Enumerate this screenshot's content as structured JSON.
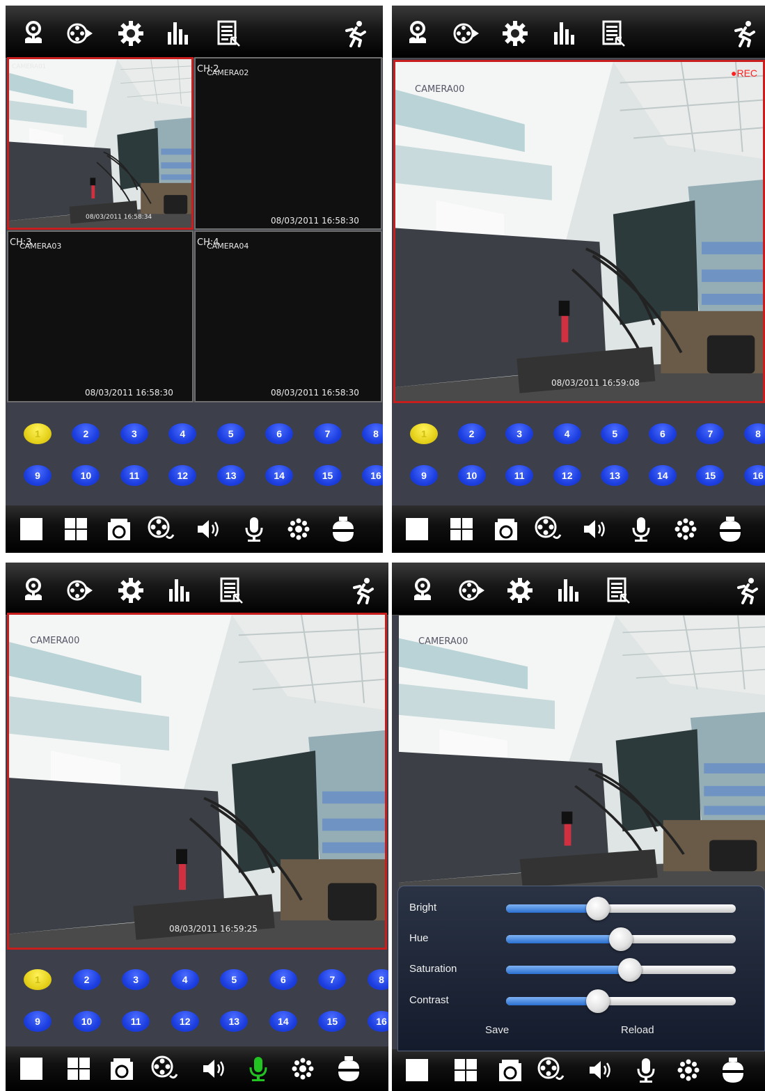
{
  "topbar_icons": [
    "ptz-flower-icon",
    "playback-icon",
    "settings-gear-icon",
    "stats-bars-icon",
    "log-list-icon",
    "motion-run-icon"
  ],
  "bottombar_icons": [
    "single-view-icon",
    "quad-view-icon",
    "snapshot-camera-icon",
    "record-film-icon",
    "speaker-audio-icon",
    "microphone-icon",
    "image-adjust-icon",
    "ptz-dome-icon"
  ],
  "channels": [
    "1",
    "2",
    "3",
    "4",
    "5",
    "6",
    "7",
    "8",
    "9",
    "10",
    "11",
    "12",
    "13",
    "14",
    "15",
    "16"
  ],
  "selected_channel": "1",
  "colors": {
    "active_border": "#c81e1e",
    "channel_blue": "#1d3fe0",
    "channel_selected": "#e6d21c",
    "mic_active": "#22c422",
    "rec_red": "#ff2020"
  },
  "screen1": {
    "cells": [
      {
        "ch": "",
        "cam": "CAMERA01",
        "timestamp": "08/03/2011 16:58:34"
      },
      {
        "ch": "CH:2",
        "cam": "CAMERA02",
        "timestamp": "08/03/2011 16:58:30"
      },
      {
        "ch": "CH:3",
        "cam": "CAMERA03",
        "timestamp": "08/03/2011 16:58:30"
      },
      {
        "ch": "CH:4",
        "cam": "CAMERA04",
        "timestamp": "08/03/2011 16:58:30"
      }
    ]
  },
  "screen2": {
    "cam": "CAMERA00",
    "timestamp": "08/03/2011 16:59:08",
    "rec": "●REC"
  },
  "screen3": {
    "cam": "CAMERA00",
    "timestamp": "08/03/2011 16:59:25"
  },
  "screen4": {
    "cam": "CAMERA00",
    "settings": {
      "bright_label": "Bright",
      "bright_level": 0.4,
      "hue_label": "Hue",
      "hue_level": 0.5,
      "saturation_label": "Saturation",
      "saturation_level": 0.54,
      "contrast_label": "Contrast",
      "contrast_level": 0.4,
      "save_label": "Save",
      "reload_label": "Reload"
    }
  }
}
